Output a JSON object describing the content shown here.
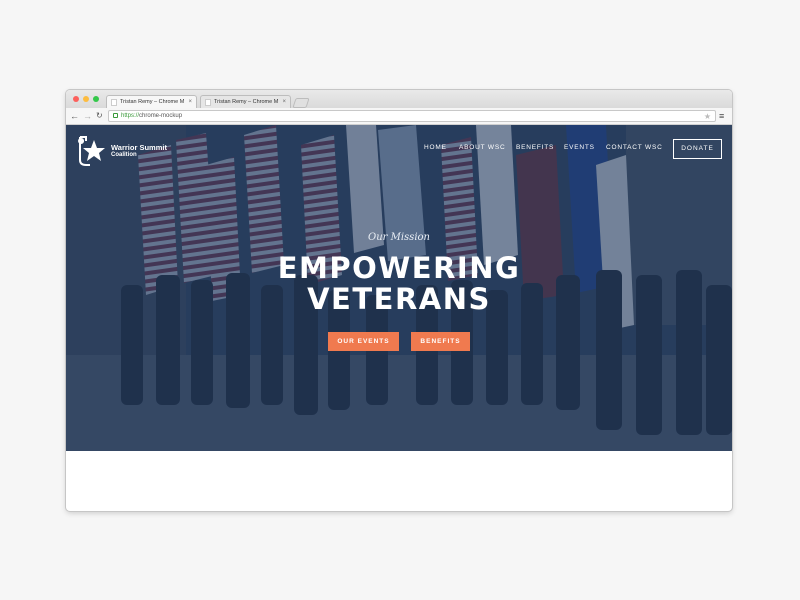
{
  "browser": {
    "tabs": [
      {
        "label": "Tristan Remy – Chrome M",
        "close": "×"
      },
      {
        "label": "Tristan Remy – Chrome M",
        "close": "×"
      }
    ],
    "url_scheme": "https://",
    "url_rest": "chrome-mockup",
    "icons": {
      "back": "arrow-left-icon",
      "forward": "arrow-right-icon",
      "reload": "reload-icon",
      "bookmark": "star-icon",
      "menu": "hamburger-menu-icon"
    }
  },
  "site": {
    "logo": {
      "line1": "Warrior Summit",
      "line2": "Coalition",
      "icon": "star-shield-icon"
    },
    "nav": [
      "HOME",
      "ABOUT WSC",
      "BENEFITS",
      "EVENTS",
      "CONTACT WSC"
    ],
    "donate_label": "DONATE",
    "hero": {
      "kicker": "Our Mission",
      "headline_line1": "EMPOWERING",
      "headline_line2": "VETERANS",
      "buttons": [
        "OUR EVENTS",
        "BENEFITS"
      ]
    }
  },
  "colors": {
    "hero_overlay": "#163056",
    "accent": "#f07a4f",
    "text_on_dark": "#ffffff"
  }
}
